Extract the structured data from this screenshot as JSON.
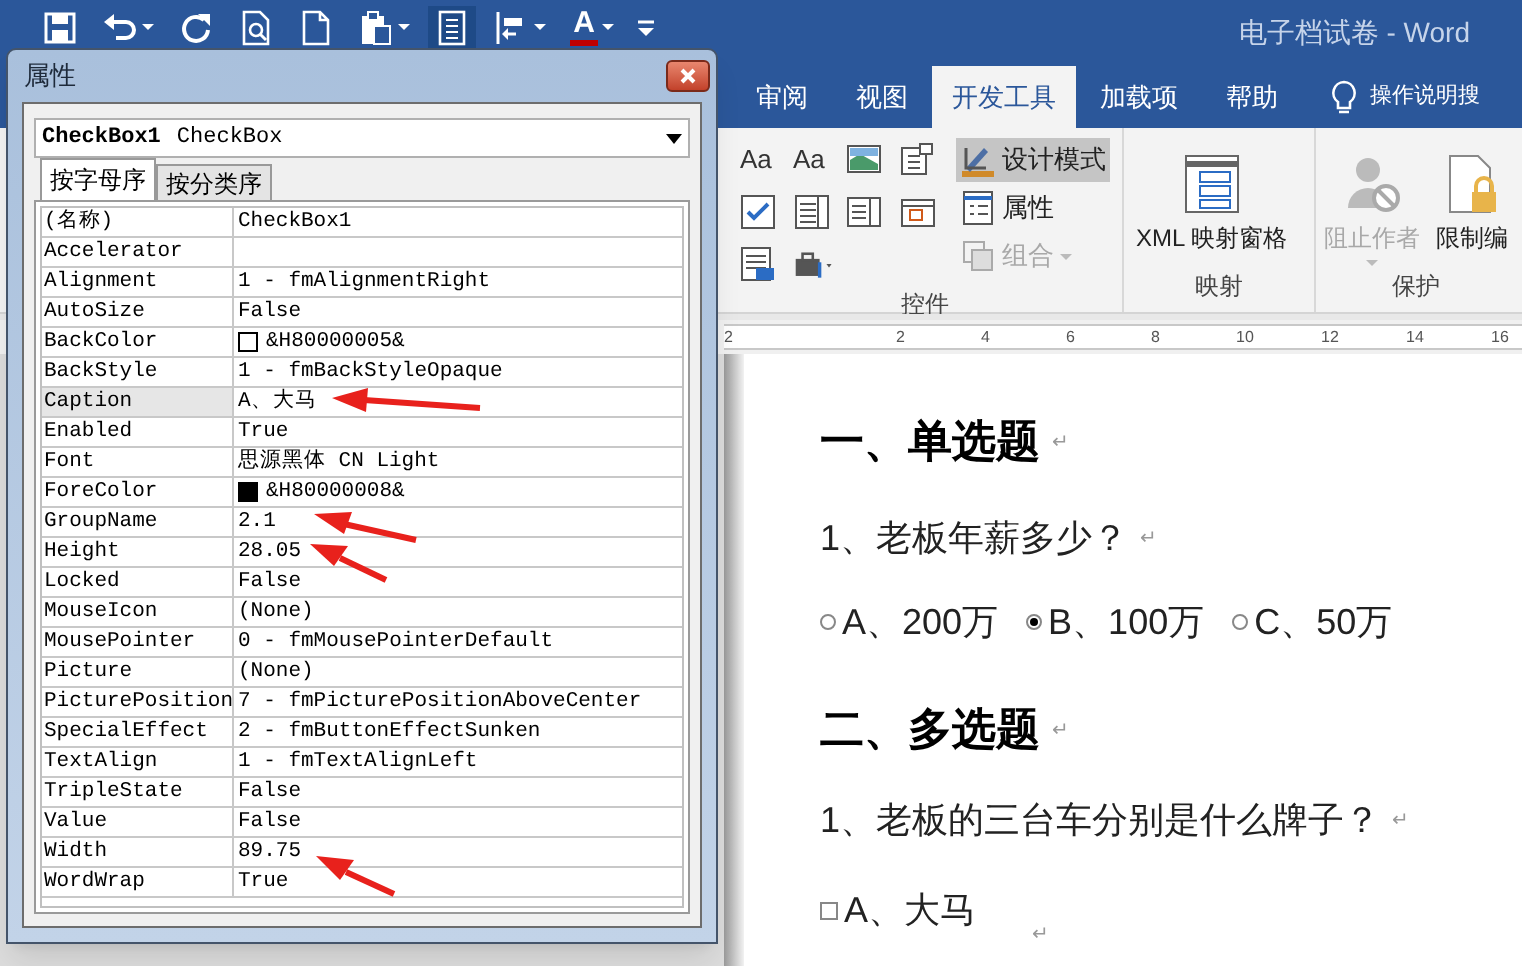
{
  "word_window": {
    "title": "电子档试卷 - Word",
    "quick_access": [
      {
        "kind": "save",
        "has_menu": false,
        "highlighted": false
      },
      {
        "kind": "undo",
        "has_menu": true,
        "highlighted": false
      },
      {
        "kind": "redo",
        "has_menu": false,
        "highlighted": false
      },
      {
        "kind": "preview",
        "has_menu": false,
        "highlighted": false
      },
      {
        "kind": "new",
        "has_menu": false,
        "highlighted": false
      },
      {
        "kind": "paste",
        "has_menu": true,
        "highlighted": false
      },
      {
        "kind": "list",
        "has_menu": false,
        "highlighted": true
      },
      {
        "kind": "indent",
        "has_menu": true,
        "highlighted": false
      },
      {
        "kind": "font-color",
        "label": "A",
        "has_menu": true,
        "highlighted": false
      },
      {
        "kind": "customize",
        "has_menu": false,
        "highlighted": false
      }
    ],
    "tabs": [
      {
        "label": "审阅",
        "selected": false
      },
      {
        "label": "视图",
        "selected": false
      },
      {
        "label": "开发工具",
        "selected": true
      },
      {
        "label": "加载项",
        "selected": false
      },
      {
        "label": "帮助",
        "selected": false
      }
    ],
    "tell_me": "操作说明搜",
    "groups": [
      {
        "label": "控件",
        "small_controls": [
          {
            "kind": "text",
            "label": "Aa"
          },
          {
            "kind": "text",
            "label": "Aa"
          },
          {
            "kind": "picture"
          },
          {
            "kind": "gallery"
          },
          {
            "kind": "checkbox"
          },
          {
            "kind": "combo"
          },
          {
            "kind": "list"
          },
          {
            "kind": "date"
          },
          {
            "kind": "repeat"
          },
          {
            "kind": "tools"
          }
        ],
        "buttons": [
          {
            "kind": "design",
            "label": "设计模式",
            "on": true,
            "disabled": false
          },
          {
            "kind": "properties",
            "label": "属性",
            "on": false,
            "disabled": false
          },
          {
            "kind": "group",
            "label": "组合",
            "on": false,
            "disabled": true
          }
        ]
      },
      {
        "label": "映射",
        "buttons": [
          {
            "kind": "xml",
            "label": "XML 映射窗格",
            "disabled": false
          }
        ]
      },
      {
        "label": "保护",
        "buttons": [
          {
            "kind": "block",
            "label": "阻止作者",
            "disabled": true
          },
          {
            "kind": "restrict",
            "label": "限制编",
            "disabled": false
          }
        ]
      }
    ],
    "ruler": [
      "2",
      "2",
      "4",
      "6",
      "8",
      "10",
      "12",
      "14",
      "16"
    ],
    "document": [
      {
        "kind": "heading",
        "text": "一、单选题",
        "mark": "↵"
      },
      {
        "kind": "question",
        "text": "1、老板年薪多少？",
        "mark": "↵"
      },
      {
        "kind": "radios",
        "options": [
          {
            "label": "A、200万",
            "selected": false
          },
          {
            "label": "B、100万",
            "selected": true
          },
          {
            "label": "C、50万",
            "selected": false
          }
        ]
      },
      {
        "kind": "heading",
        "text": "二、多选题",
        "mark": "↵"
      },
      {
        "kind": "question",
        "text": "1、老板的三台车分别是什么牌子？",
        "mark": "↵"
      },
      {
        "kind": "checks",
        "options": [
          {
            "label": "A、大马",
            "checked": false
          }
        ],
        "mark": "↵"
      }
    ]
  },
  "properties_window": {
    "title": "属性",
    "object_name": "CheckBox1",
    "object_type": "CheckBox",
    "tabs": [
      {
        "label": "按字母序",
        "selected": true
      },
      {
        "label": "按分类序",
        "selected": false
      }
    ],
    "rows": [
      {
        "name": "(名称)",
        "value": "CheckBox1",
        "selected": false
      },
      {
        "name": "Accelerator",
        "value": "",
        "selected": false
      },
      {
        "name": "Alignment",
        "value": "1 - fmAlignmentRight",
        "selected": false
      },
      {
        "name": "AutoSize",
        "value": "False",
        "selected": false
      },
      {
        "name": "BackColor",
        "value": "&H80000005&",
        "color": "#ffffff",
        "selected": false
      },
      {
        "name": "BackStyle",
        "value": "1 - fmBackStyleOpaque",
        "selected": false
      },
      {
        "name": "Caption",
        "value": "A、大马",
        "selected": true
      },
      {
        "name": "Enabled",
        "value": "True",
        "selected": false
      },
      {
        "name": "Font",
        "value": "思源黑体 CN Light",
        "selected": false
      },
      {
        "name": "ForeColor",
        "value": "&H80000008&",
        "color": "#000000",
        "selected": false
      },
      {
        "name": "GroupName",
        "value": "2.1",
        "selected": false
      },
      {
        "name": "Height",
        "value": "28.05",
        "selected": false
      },
      {
        "name": "Locked",
        "value": "False",
        "selected": false
      },
      {
        "name": "MouseIcon",
        "value": "(None)",
        "selected": false
      },
      {
        "name": "MousePointer",
        "value": "0 - fmMousePointerDefault",
        "selected": false
      },
      {
        "name": "Picture",
        "value": "(None)",
        "selected": false
      },
      {
        "name": "PicturePosition",
        "value": "7 - fmPicturePositionAboveCenter",
        "selected": false
      },
      {
        "name": "SpecialEffect",
        "value": "2 - fmButtonEffectSunken",
        "selected": false
      },
      {
        "name": "TextAlign",
        "value": "1 - fmTextAlignLeft",
        "selected": false
      },
      {
        "name": "TripleState",
        "value": "False",
        "selected": false
      },
      {
        "name": "Value",
        "value": "False",
        "selected": false
      },
      {
        "name": "Width",
        "value": "89.75",
        "selected": false
      },
      {
        "name": "WordWrap",
        "value": "True",
        "selected": false
      }
    ]
  }
}
